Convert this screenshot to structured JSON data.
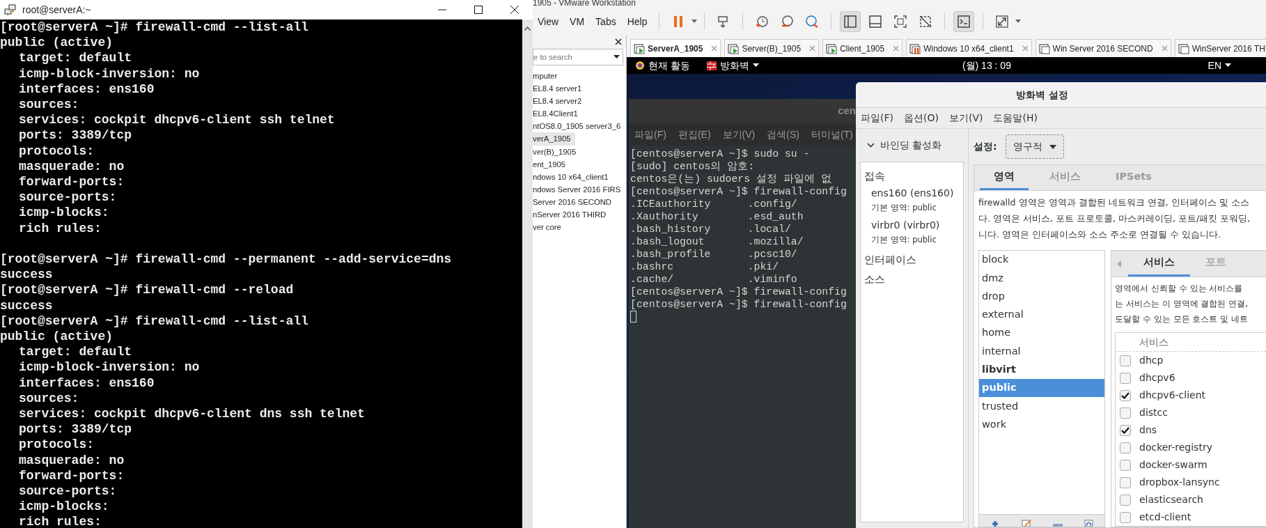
{
  "putty": {
    "title": "root@serverA:~",
    "blocks": [
      [
        "[root@serverA ~]# firewall-cmd --list-all",
        {
          "text": "public (active)",
          "children": [
            "target: default",
            "icmp-block-inversion: no",
            "interfaces: ens160",
            "sources:",
            "services: cockpit dhcpv6-client ssh telnet",
            "ports: 3389/tcp",
            "protocols:",
            "masquerade: no",
            "forward-ports:",
            "source-ports:",
            "icmp-blocks:",
            "rich rules:"
          ]
        }
      ],
      [
        "[root@serverA ~]# firewall-cmd --permanent --add-service=dns",
        "success",
        "[root@serverA ~]# firewall-cmd --reload",
        "success",
        "[root@serverA ~]# firewall-cmd --list-all",
        {
          "text": "public (active)",
          "children": [
            "target: default",
            "icmp-block-inversion: no",
            "interfaces: ens160",
            "sources:",
            "services: cockpit dhcpv6-client dns ssh telnet",
            "ports: 3389/tcp",
            "protocols:",
            "masquerade: no",
            "forward-ports:",
            "source-ports:",
            "icmp-blocks:",
            "rich rules:"
          ]
        }
      ]
    ]
  },
  "vmware": {
    "title": "1905 - VMware Workstation",
    "menu": [
      "View",
      "VM",
      "Tabs",
      "Help"
    ],
    "library": {
      "search_placeholder": "e to search",
      "items": [
        {
          "label": "mputer",
          "selected": false
        },
        {
          "label": "EL8.4 server1",
          "selected": false
        },
        {
          "label": "EL8.4 server2",
          "selected": false
        },
        {
          "label": "EL8.4Client1",
          "selected": false
        },
        {
          "label": "ntOS8.0_1905 server3_6",
          "selected": false
        },
        {
          "label": "verA_1905",
          "selected": true
        },
        {
          "label": "ver(B)_1905",
          "selected": false
        },
        {
          "label": "ent_1905",
          "selected": false
        },
        {
          "label": "ndows 10 x64_client1",
          "selected": false
        },
        {
          "label": "ndows Server 2016 FIRS",
          "selected": false
        },
        {
          "label": "Server 2016 SECOND",
          "selected": false
        },
        {
          "label": "nServer 2016 THIRD",
          "selected": false
        },
        {
          "label": "ver core",
          "selected": false
        }
      ]
    },
    "tabs": [
      {
        "label": "ServerA_1905",
        "selected": true,
        "running": true,
        "suspended": false
      },
      {
        "label": "Server(B)_1905",
        "selected": false,
        "running": true,
        "suspended": false
      },
      {
        "label": "Client_1905",
        "selected": false,
        "running": true,
        "suspended": false
      },
      {
        "label": "Windows 10 x64_client1",
        "selected": false,
        "running": false,
        "suspended": true
      },
      {
        "label": "Win Server 2016 SECOND",
        "selected": false,
        "running": false,
        "suspended": false
      },
      {
        "label": "WinServer 2016 THI",
        "selected": false,
        "running": false,
        "suspended": false
      }
    ]
  },
  "guest": {
    "activities": "현재 활동",
    "app_menu": "방화벽",
    "clock": "(월) 13 : 09",
    "input_source": "EN"
  },
  "terminal": {
    "title": "cen",
    "menu": [
      "파일(F)",
      "편집(E)",
      "보기(V)",
      "검색(S)",
      "터미널(T)"
    ],
    "lines": [
      "[centos@serverA ~]$ sudo su -",
      "[sudo] centos의 암호:",
      "centos은(는) sudoers 설정 파일에 없",
      "[centos@serverA ~]$ firewall-config",
      {
        "columns": [
          ".ICEauthority",
          ".config/"
        ]
      },
      {
        "columns": [
          ".Xauthority",
          ".esd_auth"
        ]
      },
      {
        "columns": [
          ".bash_history",
          ".local/"
        ]
      },
      {
        "columns": [
          ".bash_logout",
          ".mozilla/"
        ]
      },
      {
        "columns": [
          ".bash_profile",
          ".pcsc10/"
        ]
      },
      {
        "columns": [
          ".bashrc",
          ".pki/"
        ]
      },
      {
        "columns": [
          ".cache/",
          ".viminfo"
        ]
      },
      "[centos@serverA ~]$ firewall-config",
      "[centos@serverA ~]$ firewall-config"
    ]
  },
  "firewall": {
    "title": "방화벽 설정",
    "menu": [
      "파일(F)",
      "옵션(O)",
      "보기(V)",
      "도움말(H)"
    ],
    "binding": "바인딩 활성화",
    "connections_heading": "접속",
    "connections": [
      {
        "name": "ens160 (ens160)",
        "zone_label": "기본 영역:",
        "zone": "public"
      },
      {
        "name": "virbr0 (virbr0)",
        "zone_label": "기본 영역:",
        "zone": "public"
      }
    ],
    "interfaces_heading": "인터페이스",
    "sources_heading": "소스",
    "config_label": "설정:",
    "config_value": "영구적",
    "tabs": [
      {
        "label": "영역",
        "selected": true
      },
      {
        "label": "서비스",
        "selected": false
      },
      {
        "label": "IPSets",
        "selected": false
      }
    ],
    "description": [
      "firewalld 영역은 영역과 결합된 네트워크 연결, 인터페이스 및 소스",
      "다. 영역은 서비스, 포트 프로토콜, 마스커레이딩, 포트/패킷 포워딩,",
      "니다. 영역은 인터페이스와 소스 주소로 연결될 수 있습니다."
    ],
    "zones": [
      {
        "name": "block",
        "selected": false,
        "active": false
      },
      {
        "name": "dmz",
        "selected": false,
        "active": false
      },
      {
        "name": "drop",
        "selected": false,
        "active": false
      },
      {
        "name": "external",
        "selected": false,
        "active": false
      },
      {
        "name": "home",
        "selected": false,
        "active": false
      },
      {
        "name": "internal",
        "selected": false,
        "active": false
      },
      {
        "name": "libvirt",
        "selected": false,
        "active": true
      },
      {
        "name": "public",
        "selected": true,
        "active": false
      },
      {
        "name": "trusted",
        "selected": false,
        "active": false
      },
      {
        "name": "work",
        "selected": false,
        "active": false
      }
    ],
    "zone_tabs": [
      {
        "label": "서비스",
        "selected": true
      },
      {
        "label": "포트",
        "selected": false
      }
    ],
    "zone_description": [
      "영역에서 신뢰할 수 있는 서비스를",
      "는 서비스는 이 영역에 결합된 연결,",
      "도달할 수 있는 모든 호스트 및 네트"
    ],
    "services_column": "서비스",
    "services": [
      {
        "name": "dhcp",
        "checked": false
      },
      {
        "name": "dhcpv6",
        "checked": false
      },
      {
        "name": "dhcpv6-client",
        "checked": true
      },
      {
        "name": "distcc",
        "checked": false
      },
      {
        "name": "dns",
        "checked": true
      },
      {
        "name": "docker-registry",
        "checked": false
      },
      {
        "name": "docker-swarm",
        "checked": false
      },
      {
        "name": "dropbox-lansync",
        "checked": false
      },
      {
        "name": "elasticsearch",
        "checked": false
      },
      {
        "name": "etcd-client",
        "checked": false
      }
    ]
  }
}
